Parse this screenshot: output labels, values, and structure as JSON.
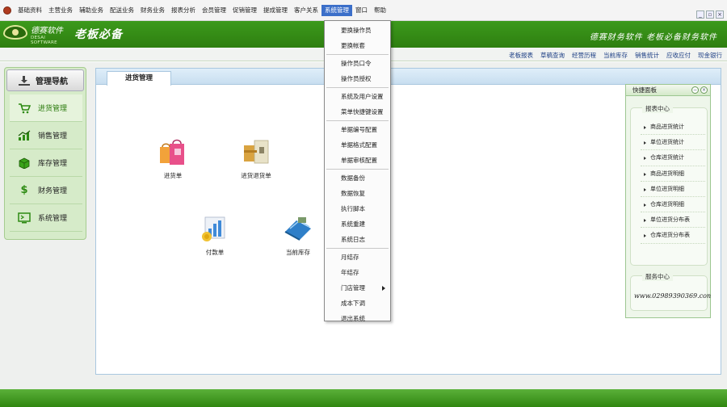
{
  "menubar": {
    "items": [
      "基础资料",
      "主营业务",
      "辅助业务",
      "配送业务",
      "财务业务",
      "报表分析",
      "会员管理",
      "促销管理",
      "提成管理",
      "客户关系",
      "系统管理",
      "窗口",
      "帮助"
    ],
    "active_index": 10
  },
  "banner": {
    "logo_cn": "德赛软件",
    "logo_en": "DESAI SOFTWARE",
    "title": "老板必备",
    "slogan": "德赛财务软件  老板必备财务软件"
  },
  "quicklinks": [
    "老板报表",
    "草稿查询",
    "经营历程",
    "当前库存",
    "销售统计",
    "应收应付",
    "现金银行"
  ],
  "nav": {
    "title": "管理导航",
    "items": [
      {
        "label": "进货管理",
        "icon": "cart-icon",
        "active": true
      },
      {
        "label": "销售管理",
        "icon": "chart-up-icon",
        "active": false
      },
      {
        "label": "库存管理",
        "icon": "inventory-icon",
        "active": false
      },
      {
        "label": "财务管理",
        "icon": "dollar-icon",
        "active": false
      },
      {
        "label": "系统管理",
        "icon": "system-icon",
        "active": false
      }
    ]
  },
  "content": {
    "tab": "进货管理",
    "tiles": [
      "进货单",
      "进货退货单",
      "付款单",
      "当前库存"
    ]
  },
  "quick_panel": {
    "title": "快捷面板",
    "report_group": "报表中心",
    "reports": [
      "商品进货统计",
      "单位进货统计",
      "仓库进货统计",
      "商品进货明细",
      "单位进货明细",
      "仓库进货明细",
      "单位进货分布表",
      "仓库进货分布表"
    ],
    "service_group": "服务中心",
    "service_phone": "www.02989390369.con"
  },
  "dropdown": {
    "groups": [
      [
        "更换操作员",
        "更换帐套"
      ],
      [
        "操作员口令",
        "操作员授权"
      ],
      [
        "系统及用户设置",
        "菜单快捷键设置"
      ],
      [
        "单据编号配置",
        "单据格式配置",
        "单据审核配置"
      ],
      [
        "数据备份",
        "数据恢复",
        "执行脚本",
        "系统重建",
        "系统日志"
      ],
      [
        "月结存",
        "年结存",
        "门店管理",
        "成本下调",
        "退出系统"
      ]
    ]
  },
  "colors": {
    "brand_green": "#3c9a1c",
    "menu_highlight": "#3b6fc9",
    "link_blue": "#1d3f85"
  }
}
